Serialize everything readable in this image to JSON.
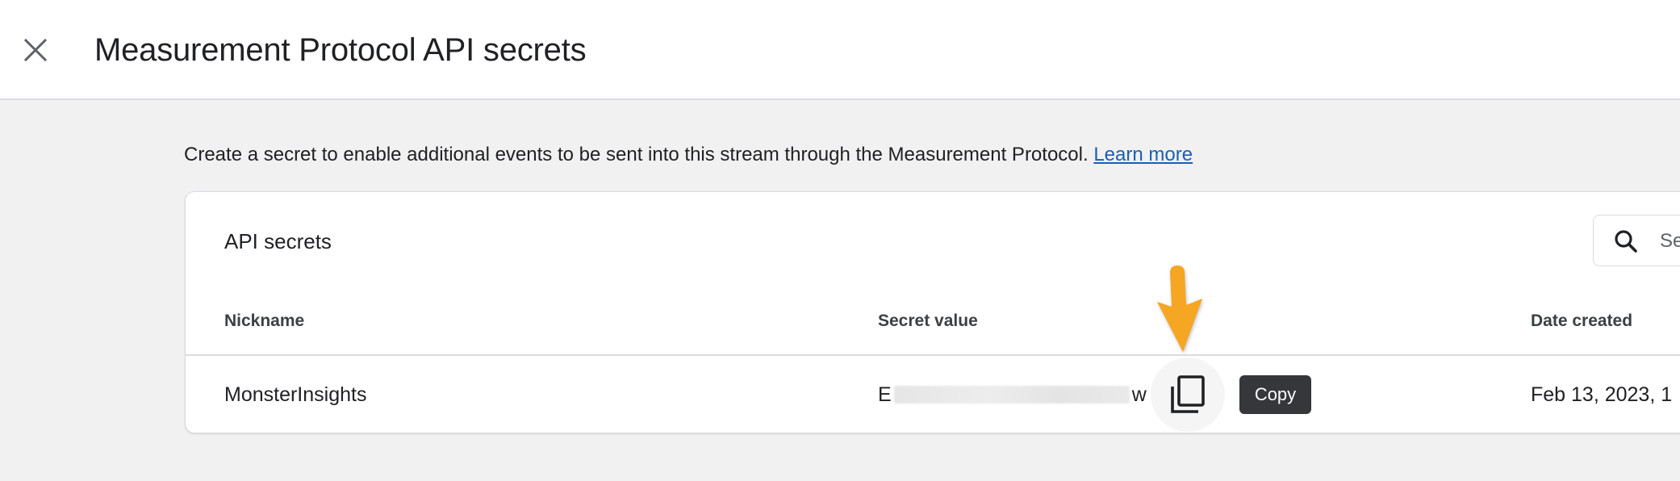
{
  "header": {
    "title": "Measurement Protocol API secrets",
    "close_icon": "close-icon"
  },
  "description": {
    "text": "Create a secret to enable additional events to be sent into this stream through the Measurement Protocol. ",
    "link_label": "Learn more"
  },
  "card": {
    "title": "API secrets",
    "search": {
      "placeholder": "Search",
      "value": "",
      "icon": "search-icon"
    },
    "columns": [
      "Nickname",
      "Secret value",
      "Date created"
    ],
    "rows": [
      {
        "nickname": "MonsterInsights",
        "secret_value": {
          "visible_prefix": "E",
          "redacted": true,
          "visible_suffix": "w"
        },
        "copy_icon": "copy-icon",
        "copy_tooltip": "Copy",
        "date_created": "Feb 13, 2023, 1"
      }
    ]
  },
  "annotation": {
    "type": "arrow-down",
    "color": "#f5a623",
    "points_to": "copy-button"
  },
  "colors": {
    "link": "#1a5fb4",
    "background": "#f1f1f1",
    "tooltip_bg": "#35373b",
    "arrow": "#f5a623"
  }
}
